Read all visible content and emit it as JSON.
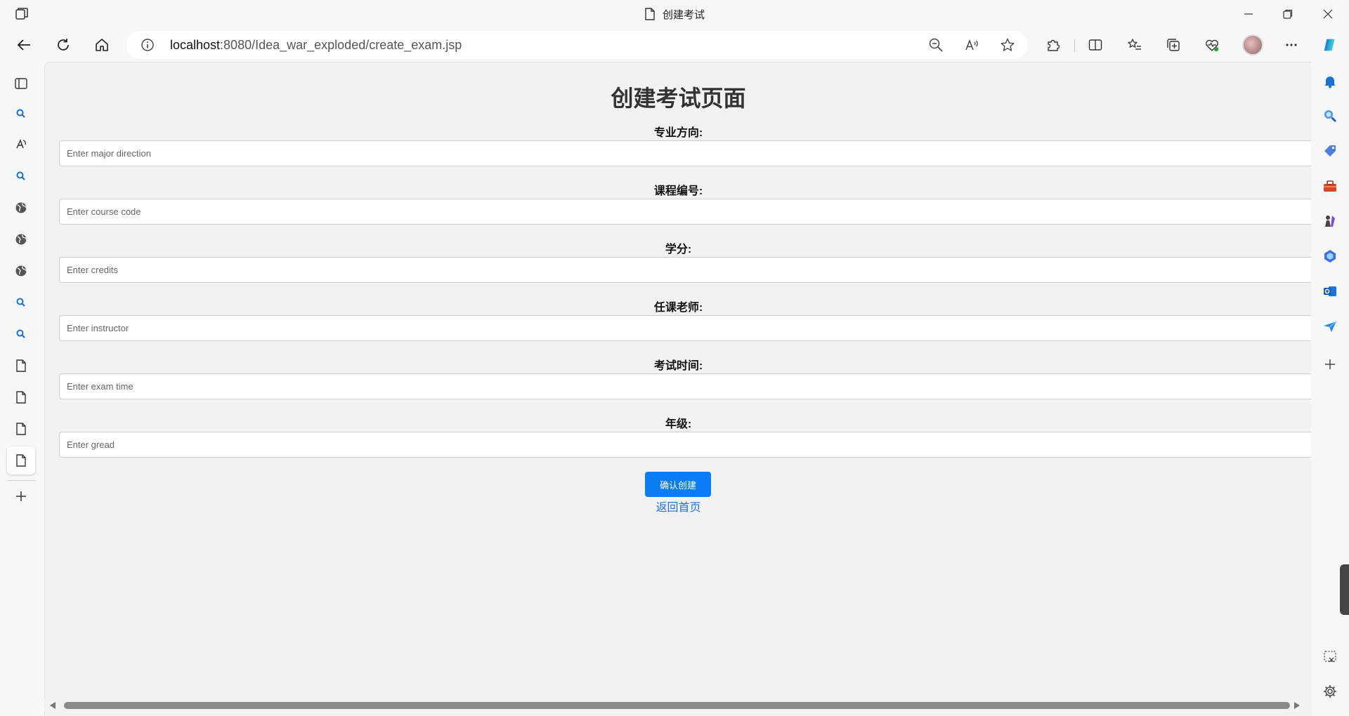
{
  "window": {
    "tab_title": "创建考试"
  },
  "address_bar": {
    "url_host": "localhost",
    "url_rest": ":8080/Idea_war_exploded/create_exam.jsp"
  },
  "page": {
    "heading": "创建考试页面",
    "fields": [
      {
        "label": "专业方向:",
        "placeholder": "Enter major direction",
        "value": ""
      },
      {
        "label": "课程编号:",
        "placeholder": "Enter course code",
        "value": ""
      },
      {
        "label": "学分:",
        "placeholder": "Enter credits",
        "value": ""
      },
      {
        "label": "任课老师:",
        "placeholder": "Enter instructor",
        "value": ""
      },
      {
        "label": "考试时间:",
        "placeholder": "Enter exam time",
        "value": ""
      },
      {
        "label": "年级:",
        "placeholder": "Enter gread",
        "value": ""
      }
    ],
    "submit_label": "确认创建",
    "back_link": "返回首页"
  },
  "colors": {
    "primary_button": "#0a7cf4",
    "link": "#1a73e8",
    "page_background": "#f2f2f2"
  }
}
